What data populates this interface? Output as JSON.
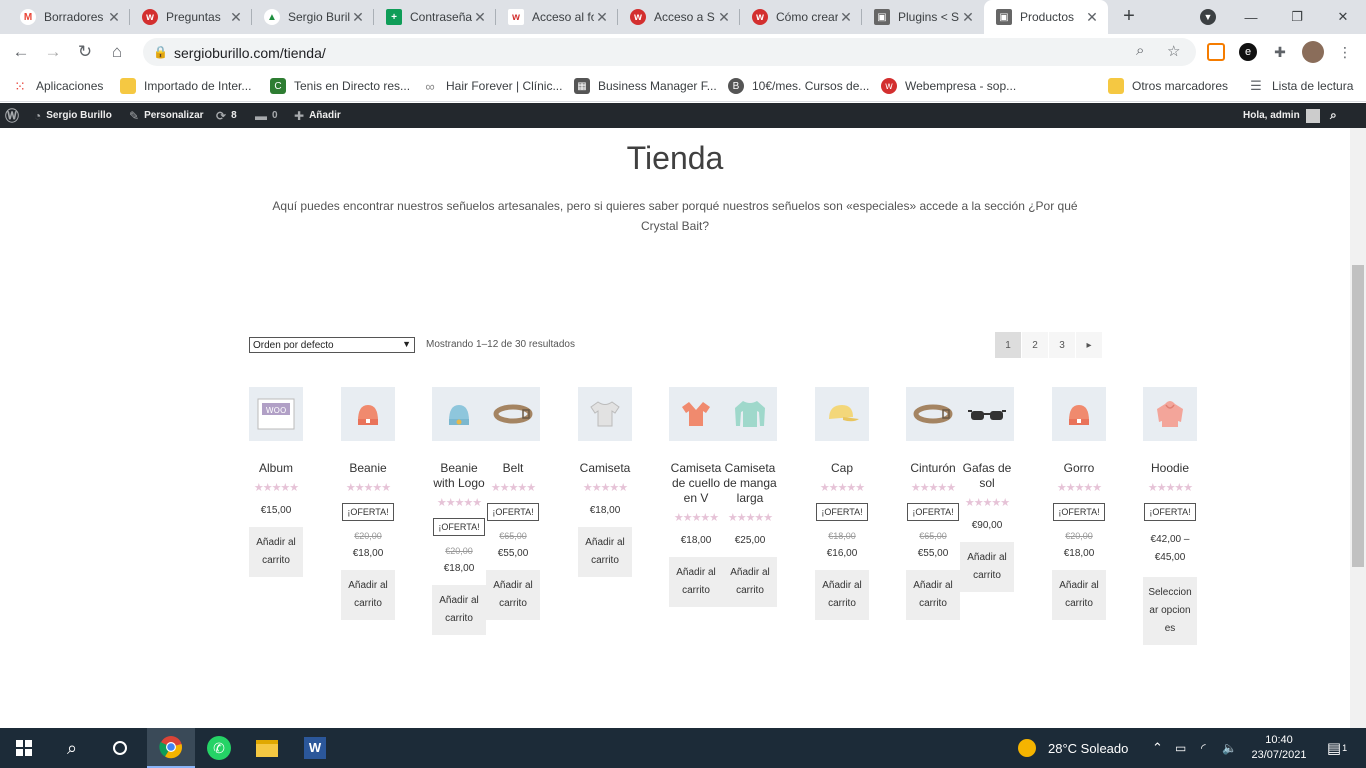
{
  "tabs": [
    {
      "title": "Borradores",
      "color": "#ea4335",
      "glyph": "M"
    },
    {
      "title": "Preguntas",
      "color": "#d32f2f",
      "glyph": "w"
    },
    {
      "title": "Sergio Burillo",
      "color": "#1e8e3e",
      "glyph": "▲"
    },
    {
      "title": "Contraseñas",
      "color": "#0f9d58",
      "glyph": "+"
    },
    {
      "title": "Acceso al foro",
      "color": "#d32f2f",
      "glyph": "w"
    },
    {
      "title": "Acceso a S",
      "color": "#d32f2f",
      "glyph": "w"
    },
    {
      "title": "Cómo crear",
      "color": "#d32f2f",
      "glyph": "w"
    },
    {
      "title": "Plugins < S",
      "color": "#555555",
      "glyph": "▣"
    },
    {
      "title": "Productos",
      "color": "#555555",
      "glyph": "▣"
    }
  ],
  "address": {
    "url": "sergioburillo.com/tienda/"
  },
  "bookmarks": [
    {
      "label": "Aplicaciones",
      "icon": "apps-grid-icon"
    },
    {
      "label": "Importado de Inter...",
      "icon": "folder-icon"
    },
    {
      "label": "Tenis en Directo res...",
      "icon": "tennis-icon"
    },
    {
      "label": "Hair Forever | Clínic...",
      "icon": "link-icon"
    },
    {
      "label": "Business Manager F...",
      "icon": "image-icon"
    },
    {
      "label": "10€/mes. Cursos de...",
      "icon": "b-icon"
    },
    {
      "label": "Webempresa - sop...",
      "icon": "webempresa-icon"
    },
    {
      "label": "Otros marcadores",
      "icon": "folder-icon"
    },
    {
      "label": "Lista de lectura",
      "icon": "reading-list-icon"
    }
  ],
  "adminbar": {
    "site": "Sergio Burillo",
    "customize": "Personalizar",
    "updates": "8",
    "comments": "0",
    "add": "Añadir",
    "greeting": "Hola, admin"
  },
  "shop": {
    "title": "Tienda",
    "intro": "Aquí puedes encontrar nuestros señuelos artesanales, pero si quieres saber porqué nuestros señuelos son «especiales» accede a la sección ¿Por qué Crystal Bait?",
    "sort_selected": "Orden por defecto",
    "result_count": "Mostrando 1–12 de 30 resultados",
    "pages": [
      "1",
      "2",
      "3"
    ],
    "next": "▸"
  },
  "products": [
    {
      "name": "Album",
      "stars": "★★★★★",
      "sale": "",
      "old": "",
      "price": "€15,00",
      "cart": "Añadir al carrito"
    },
    {
      "name": "Beanie",
      "stars": "★★★★★",
      "sale": "¡OFERTA!",
      "old": "€20,00",
      "price": "€18,00",
      "cart": "Añadir al carrito"
    },
    {
      "name": "Beanie with Logo",
      "stars": "★★★★★",
      "sale": "¡OFERTA!",
      "old": "€20,00",
      "price": "€18,00",
      "cart": "Añadir al carrito"
    },
    {
      "name": "Belt",
      "stars": "★★★★★",
      "sale": "¡OFERTA!",
      "old": "€65,00",
      "price": "€55,00",
      "cart": "Añadir al carrito"
    },
    {
      "name": "Camiseta",
      "stars": "★★★★★",
      "sale": "",
      "old": "",
      "price": "€18,00",
      "cart": "Añadir al carrito"
    },
    {
      "name": "Camiseta de cuello en V",
      "stars": "★★★★★",
      "sale": "",
      "old": "",
      "price": "€18,00",
      "cart": "Añadir al carrito"
    },
    {
      "name": "Camiseta de manga larga",
      "stars": "★★★★★",
      "sale": "",
      "old": "",
      "price": "€25,00",
      "cart": "Añadir al carrito"
    },
    {
      "name": "Cap",
      "stars": "★★★★★",
      "sale": "¡OFERTA!",
      "old": "€18,00",
      "price": "€16,00",
      "cart": "Añadir al carrito"
    },
    {
      "name": "Cinturón",
      "stars": "★★★★★",
      "sale": "¡OFERTA!",
      "old": "€65,00",
      "price": "€55,00",
      "cart": "Añadir al carrito"
    },
    {
      "name": "Gafas de sol",
      "stars": "★★★★★",
      "sale": "",
      "old": "",
      "price": "€90,00",
      "cart": "Añadir al carrito"
    },
    {
      "name": "Gorro",
      "stars": "★★★★★",
      "sale": "¡OFERTA!",
      "old": "€20,00",
      "price": "€18,00",
      "cart": "Añadir al carrito"
    },
    {
      "name": "Hoodie",
      "stars": "★★★★★",
      "sale": "¡OFERTA!",
      "old": "",
      "price": "€42,00 – €45,00",
      "cart": "Seleccionar opciones"
    }
  ],
  "taskbar": {
    "weather": "28°C Soleado",
    "time": "10:40",
    "date": "23/07/2021",
    "notifications": "1"
  },
  "colors": {
    "adminbar": "#23282d",
    "taskbar": "#1c2b38",
    "star": "#e6c3d7"
  }
}
